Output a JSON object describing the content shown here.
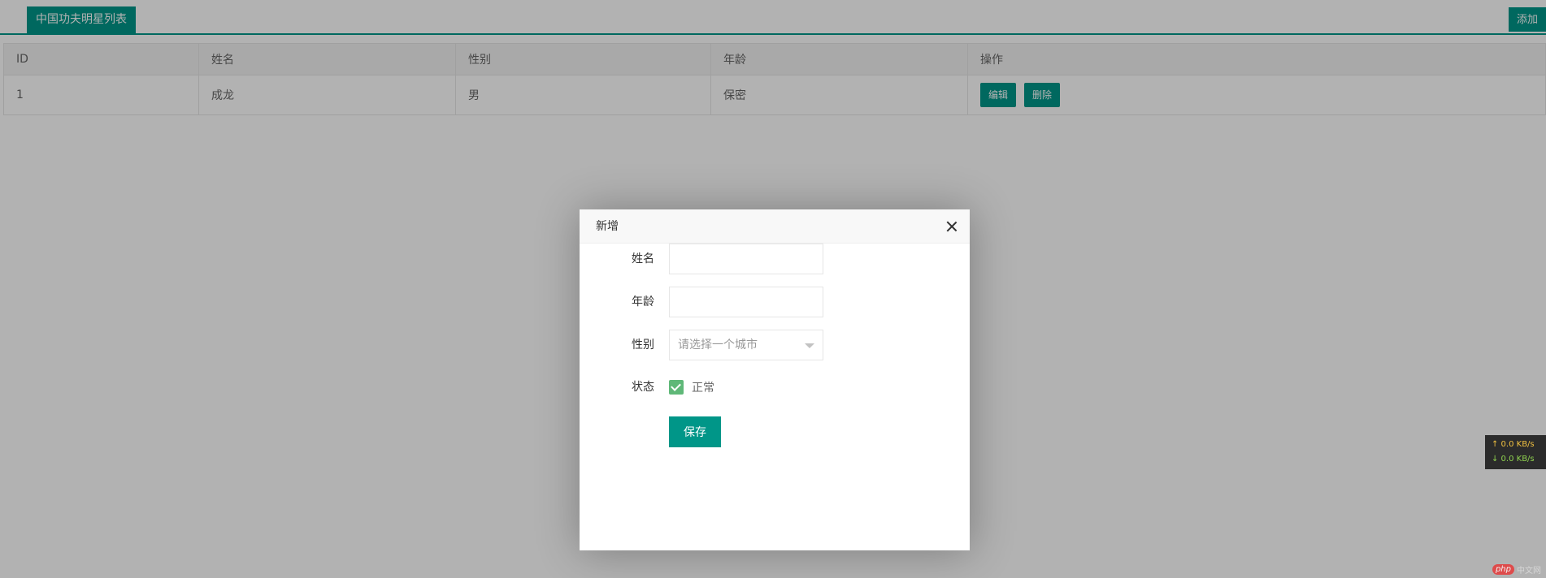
{
  "header": {
    "tab_title": "中国功夫明星列表",
    "add_label": "添加"
  },
  "table": {
    "columns": [
      "ID",
      "姓名",
      "性别",
      "年龄",
      "操作"
    ],
    "rows": [
      {
        "id": "1",
        "name": "成龙",
        "gender": "男",
        "age": "保密",
        "edit_label": "编辑",
        "delete_label": "删除"
      }
    ]
  },
  "modal": {
    "title": "新增",
    "fields": {
      "name_label": "姓名",
      "name_value": "",
      "age_label": "年龄",
      "age_value": "",
      "gender_label": "性别",
      "gender_placeholder": "请选择一个城市",
      "status_label": "状态",
      "status_checkbox_label": "正常",
      "status_checked": true
    },
    "save_label": "保存"
  },
  "netspeed": {
    "up": "↑ 0.0 KB/s",
    "down": "↓ 0.0 KB/s"
  },
  "watermark": {
    "logo": "php",
    "text": "中文网"
  },
  "colors": {
    "accent": "#009688",
    "checkbox": "#5FB878"
  }
}
